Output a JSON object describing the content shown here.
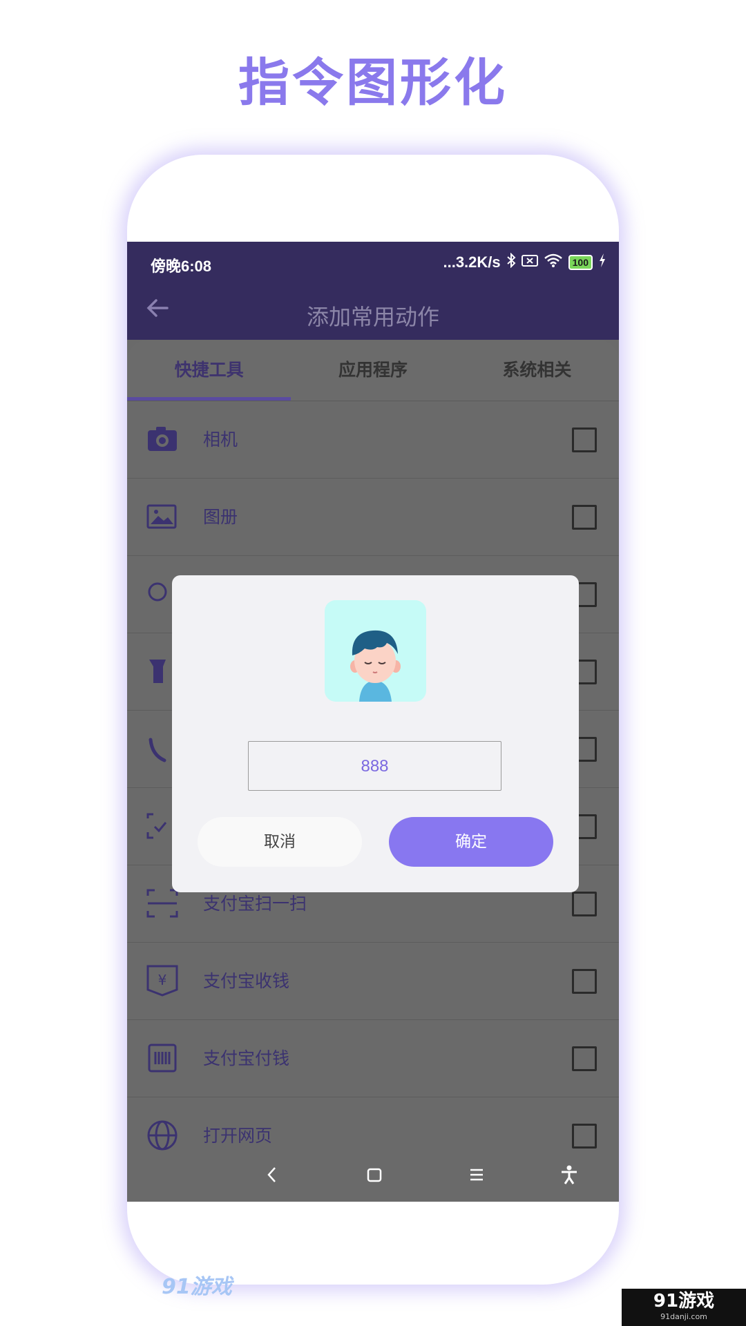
{
  "headline": "指令图形化",
  "status_bar": {
    "time": "傍晚6:08",
    "network_speed": "...3.2K/s",
    "battery": "100"
  },
  "app_bar": {
    "title": "添加常用动作"
  },
  "tabs": [
    {
      "label": "快捷工具",
      "active": true
    },
    {
      "label": "应用程序",
      "active": false
    },
    {
      "label": "系统相关",
      "active": false
    }
  ],
  "list": {
    "items": [
      {
        "label": "相机",
        "icon": "camera-icon",
        "checked": false
      },
      {
        "label": "图册",
        "icon": "gallery-icon",
        "checked": false
      },
      {
        "label": "",
        "icon": "search-icon",
        "checked": false
      },
      {
        "label": "",
        "icon": "flashlight-icon",
        "checked": false
      },
      {
        "label": "",
        "icon": "phone-icon",
        "checked": false
      },
      {
        "label": "",
        "icon": "scan-check-icon",
        "checked": false
      },
      {
        "label": "支付宝扫一扫",
        "icon": "scan-icon",
        "checked": false
      },
      {
        "label": "支付宝收钱",
        "icon": "receive-money-icon",
        "checked": false
      },
      {
        "label": "支付宝付钱",
        "icon": "barcode-icon",
        "checked": false
      },
      {
        "label": "打开网页",
        "icon": "globe-icon",
        "checked": false
      }
    ]
  },
  "dialog": {
    "input_value": "888",
    "cancel_label": "取消",
    "confirm_label": "确定"
  },
  "watermark": {
    "left": "91游戏",
    "right_big": "91游戏",
    "right_small": "91danji.com"
  },
  "colors": {
    "accent": "#8877f0",
    "header": "#352c5e",
    "overlay": "#6a6a6a"
  }
}
